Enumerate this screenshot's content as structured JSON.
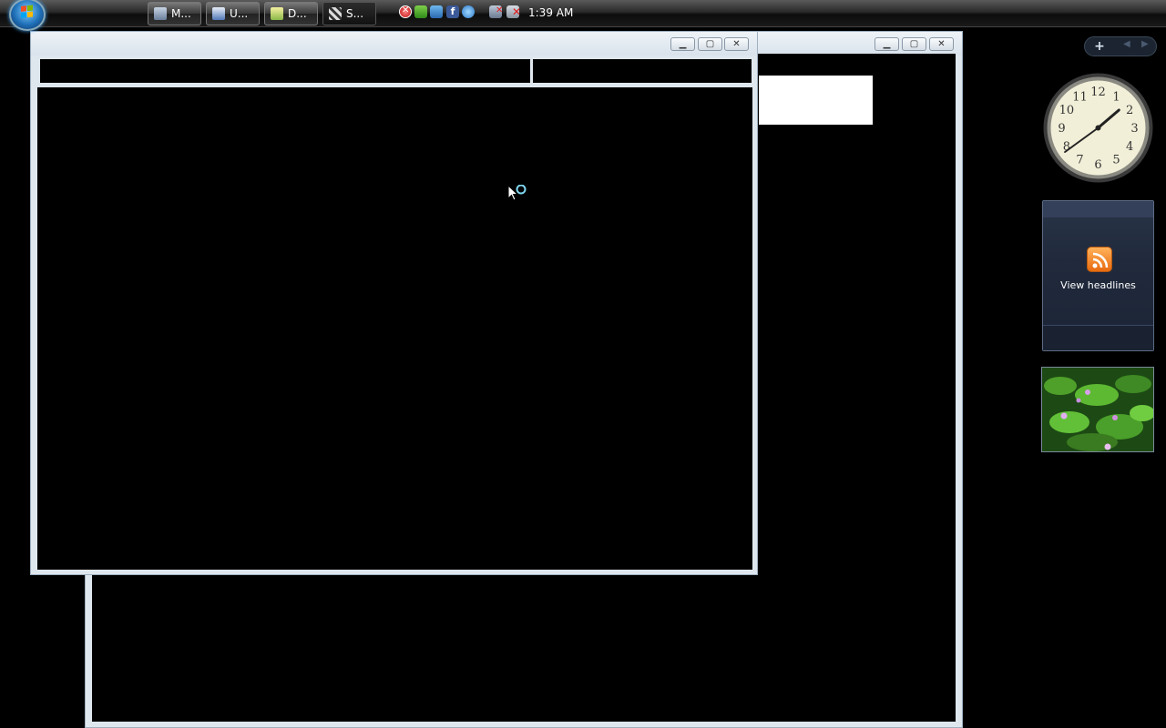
{
  "taskbar": {
    "start_button": "Start",
    "tasks": [
      {
        "label": "M...",
        "icon": "management-console-icon",
        "active": false
      },
      {
        "label": "U...",
        "icon": "document-edit-icon",
        "active": false
      },
      {
        "label": "D...",
        "icon": "notepad-icon",
        "active": false
      },
      {
        "label": "S...",
        "icon": "media-clapper-icon",
        "active": true
      }
    ],
    "tray_icons": [
      "security-alert-icon",
      "shield-check-icon",
      "network-status-icon",
      "facebook-icon",
      "messenger-icon",
      "network-disconnected-icon",
      "volume-muted-icon"
    ],
    "clock": "1:39 AM"
  },
  "windows": {
    "background_window": {
      "controls": [
        "minimize",
        "maximize",
        "close"
      ]
    },
    "foreground_window": {
      "controls": [
        "minimize",
        "maximize",
        "close"
      ]
    }
  },
  "sidebar": {
    "toolbar": {
      "add_label": "+",
      "prev_label": "◀",
      "next_label": "▶"
    },
    "clock_gadget": {
      "hour": 1,
      "minute": 39
    },
    "feed_gadget": {
      "label": "View headlines"
    },
    "slideshow_gadget": {
      "subject": "green leaves with pink flowers"
    }
  },
  "colors": {
    "accent": "#1f6fb8",
    "window_frame": "#dfe7ee",
    "rss_orange": "#f08a24"
  }
}
